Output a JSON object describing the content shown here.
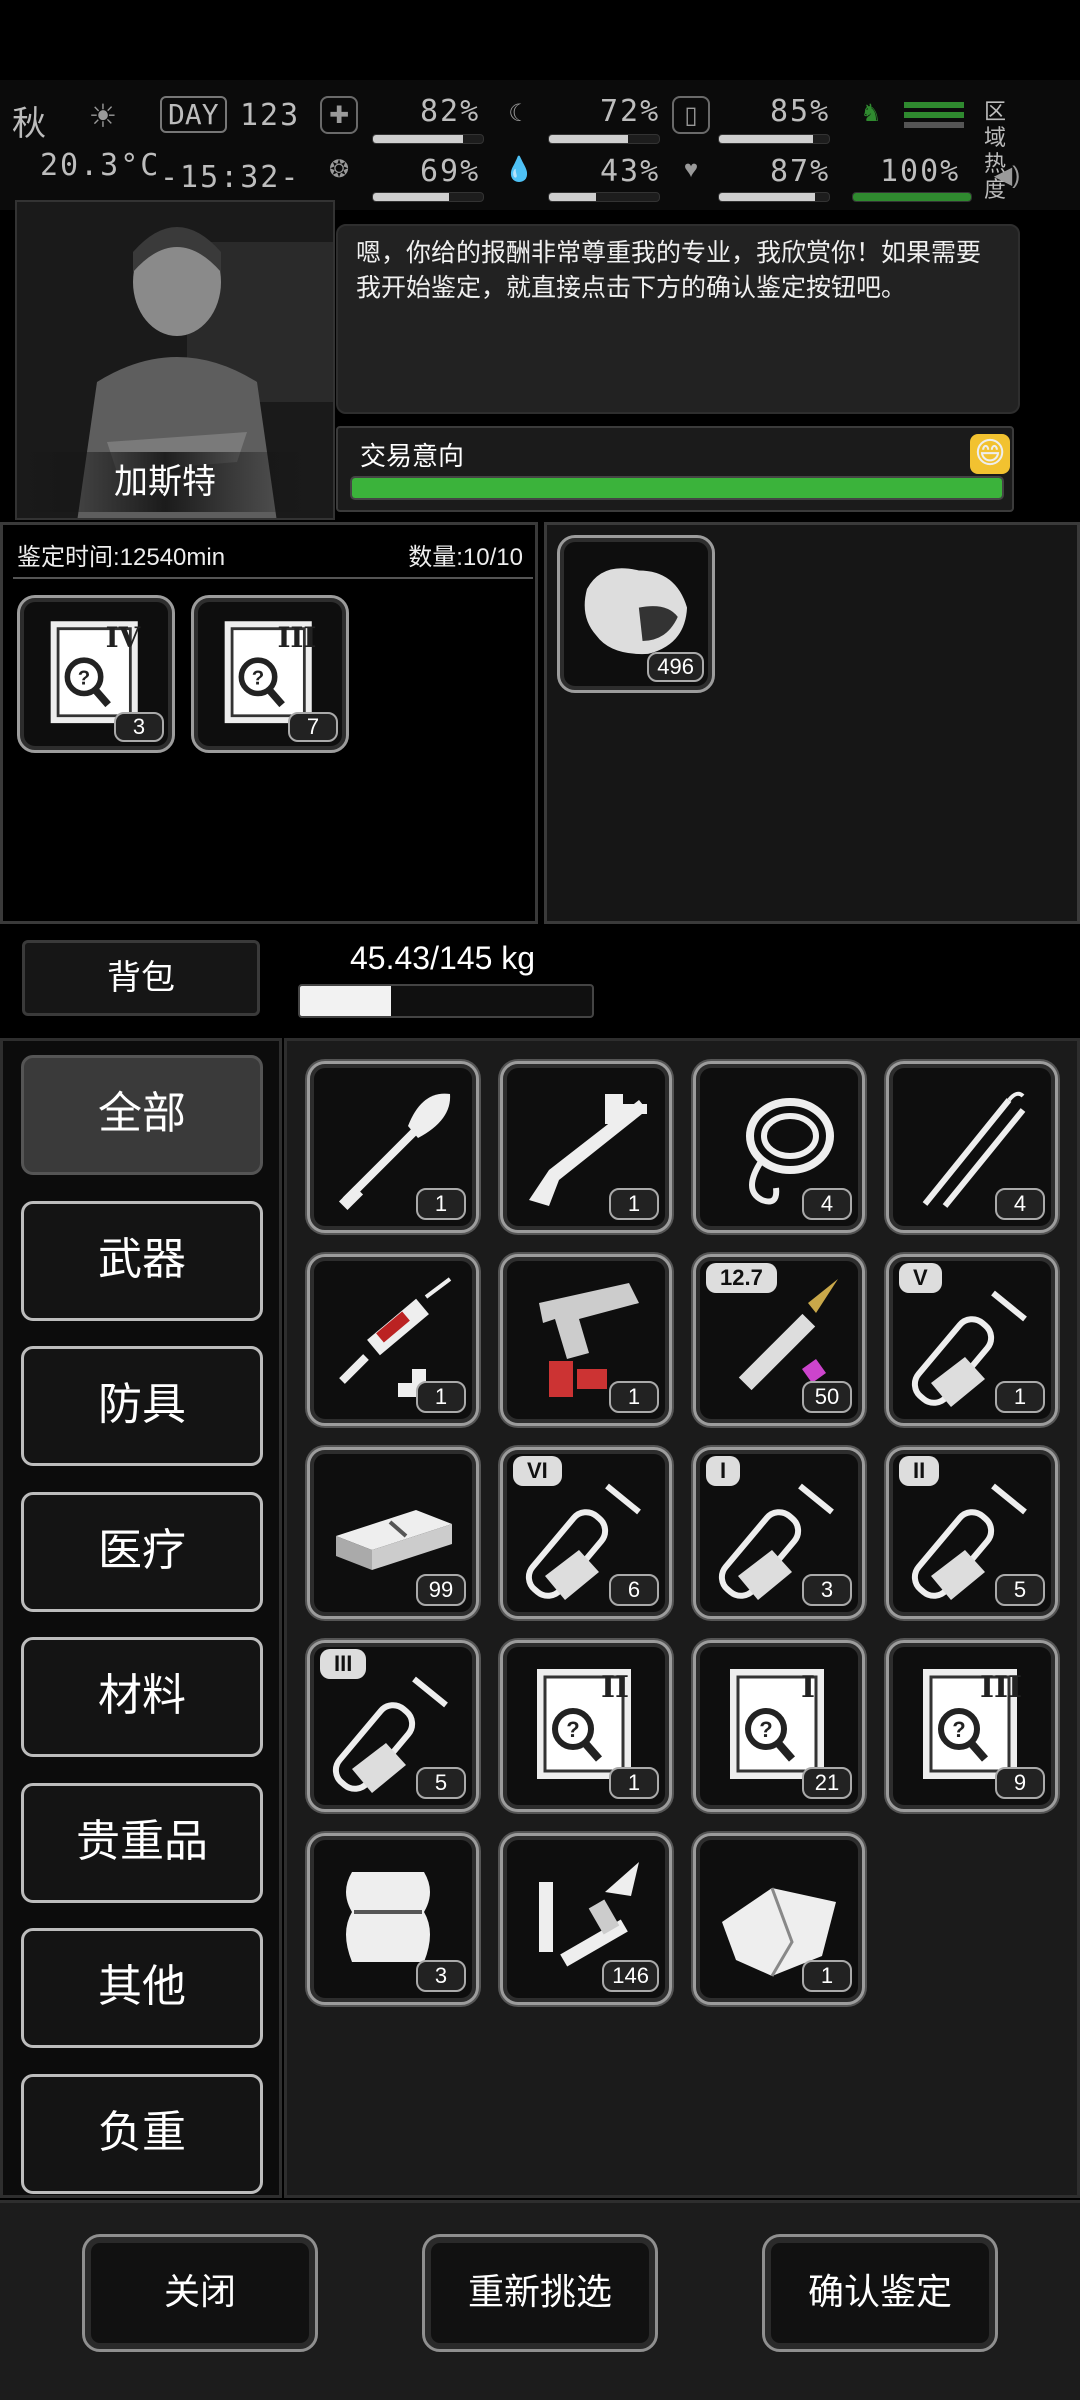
{
  "status": {
    "season": "秋",
    "day_label": "DAY",
    "day_number": "123",
    "temperature": "20.3°C",
    "time": "-15:32-",
    "health_pct": "82%",
    "hunger_pct": "72%",
    "water_pct": "85%",
    "mood_pct": "69%",
    "thirst_pct": "43%",
    "heart_pct": "87%",
    "stamina_pct": "100%",
    "zone_heat_label": "区域热度",
    "bars": {
      "health": 0.82,
      "hunger": 0.72,
      "water": 0.85,
      "mood": 0.69,
      "thirst": 0.43,
      "heart": 0.87,
      "stamina": 1.0
    }
  },
  "npc": {
    "name": "加斯特",
    "dialog": "嗯，你给的报酬非常尊重我的专业，我欣赏你！如果需要我开始鉴定，就直接点击下方的确认鉴定按钮吧。",
    "trade_label": "交易意向",
    "trade_value": 1.0,
    "mood_icon": "smile-face-icon"
  },
  "identify": {
    "time_label": "鉴定时间:12540min",
    "count_label": "数量:10/10",
    "items": [
      {
        "icon": "document-search-icon",
        "roman": "IV",
        "count": "3"
      },
      {
        "icon": "document-search-icon",
        "roman": "III",
        "count": "7"
      }
    ]
  },
  "offer": {
    "items": [
      {
        "icon": "meat-icon",
        "count": "496"
      }
    ]
  },
  "bag": {
    "button_label": "背包",
    "weight_text": "45.43/145 kg",
    "weight_fill": 0.313
  },
  "categories": [
    {
      "label": "全部",
      "active": true
    },
    {
      "label": "武器",
      "active": false
    },
    {
      "label": "防具",
      "active": false
    },
    {
      "label": "医疗",
      "active": false
    },
    {
      "label": "材料",
      "active": false
    },
    {
      "label": "贵重品",
      "active": false
    },
    {
      "label": "其他",
      "active": false
    },
    {
      "label": "负重",
      "active": false
    }
  ],
  "inventory": [
    {
      "icon": "shovel-icon",
      "count": "1"
    },
    {
      "icon": "caliper-icon",
      "count": "1"
    },
    {
      "icon": "rope-icon",
      "count": "4"
    },
    {
      "icon": "pick-tool-icon",
      "count": "4"
    },
    {
      "icon": "syringe-icon",
      "count": "1"
    },
    {
      "icon": "flare-gun-icon",
      "count": "1"
    },
    {
      "icon": "bullet-icon",
      "count": "50",
      "tag": "12.7"
    },
    {
      "icon": "test-tube-icon",
      "count": "1",
      "tag": "V"
    },
    {
      "icon": "cash-bundle-icon",
      "count": "99"
    },
    {
      "icon": "test-tube-icon",
      "count": "6",
      "tag": "VI"
    },
    {
      "icon": "test-tube-icon",
      "count": "3",
      "tag": "I"
    },
    {
      "icon": "test-tube-icon",
      "count": "5",
      "tag": "II"
    },
    {
      "icon": "test-tube-icon",
      "count": "5",
      "tag": "III"
    },
    {
      "icon": "document-search-icon",
      "count": "1",
      "roman": "II"
    },
    {
      "icon": "document-search-icon",
      "count": "21",
      "roman": "I"
    },
    {
      "icon": "document-search-icon",
      "count": "9",
      "roman": "III"
    },
    {
      "icon": "bandage-icon",
      "count": "3"
    },
    {
      "icon": "spark-plug-icon",
      "count": "146"
    },
    {
      "icon": "cloth-icon",
      "count": "1"
    }
  ],
  "footer": {
    "close_label": "关闭",
    "reselect_label": "重新挑选",
    "confirm_label": "确认鉴定"
  }
}
